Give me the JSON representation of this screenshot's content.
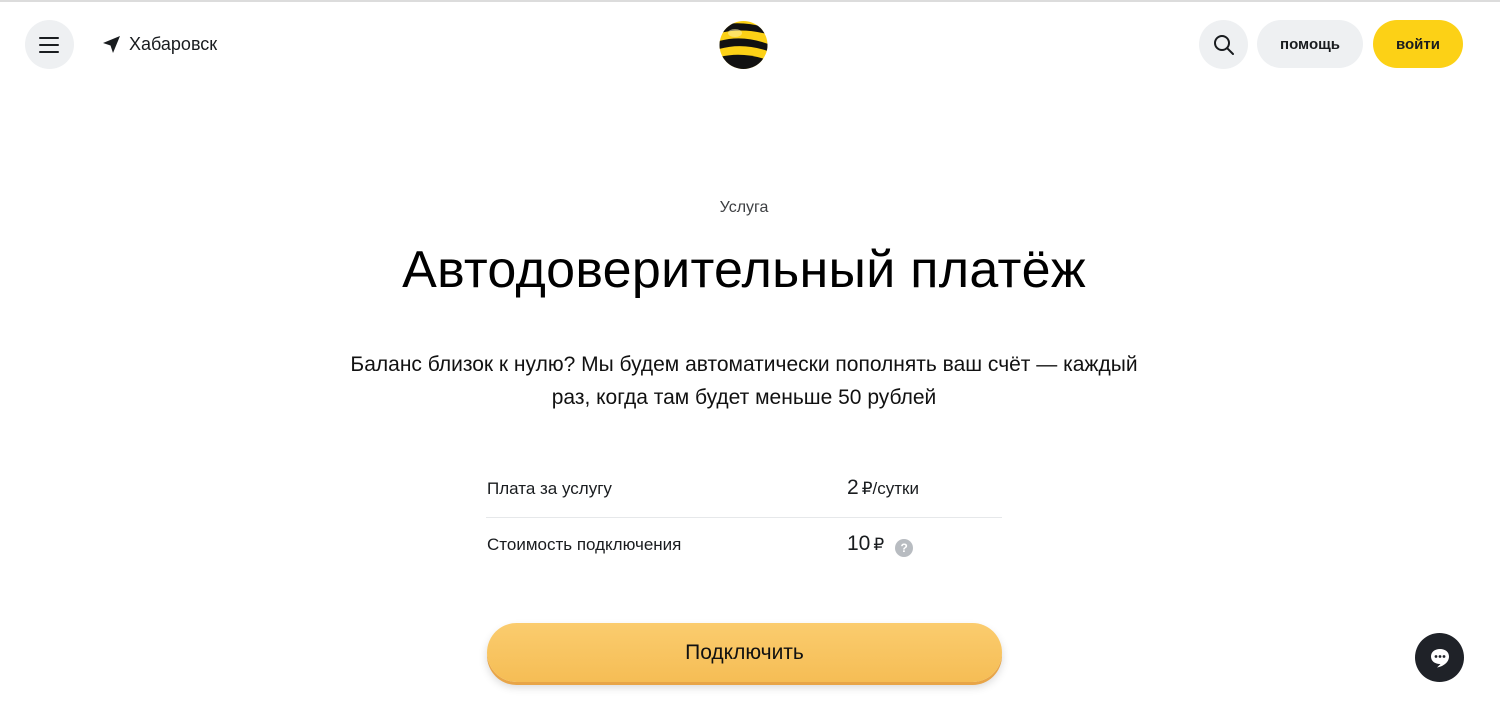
{
  "header": {
    "city": "Хабаровск",
    "help_label": "помощь",
    "login_label": "войти",
    "icons": {
      "menu": "hamburger-icon",
      "city": "location-arrow-icon",
      "logo": "beeline-logo",
      "search": "search-icon"
    }
  },
  "main": {
    "eyebrow": "Услуга",
    "title": "Автодоверительный платёж",
    "description": "Баланс близок к нулю? Мы будем автоматически пополнять ваш счёт — каждый раз, когда там будет меньше 50 рублей",
    "params": [
      {
        "label": "Плата за услугу",
        "value": "2",
        "unit": "₽/сутки"
      },
      {
        "label": "Стоимость подключения",
        "value": "10",
        "unit": "₽",
        "hint": "?"
      }
    ],
    "connect_label": "Подключить"
  },
  "chat": {
    "icon": "chat-icon"
  },
  "colors": {
    "accent": "#fcd116",
    "button_accent": "#f8c462",
    "light_bg": "#eef0f2",
    "dark": "#1f2228"
  }
}
